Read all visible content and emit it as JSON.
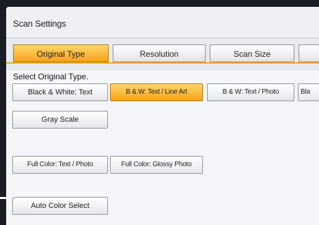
{
  "title": "Scan Settings",
  "tabs": [
    {
      "label": "Original Type"
    },
    {
      "label": "Resolution"
    },
    {
      "label": "Scan Size"
    }
  ],
  "prompt": "Select Original Type.",
  "options": {
    "bw_text": "Black & White: Text",
    "bw_text_line_art": "B & W: Text / Line Art",
    "bw_text_photo": "B & W: Text / Photo",
    "partial": "Bla",
    "gray_scale": "Gray Scale",
    "fc_text_photo": "Full Color: Text / Photo",
    "fc_glossy_photo": "Full Color: Glossy Photo",
    "auto_color_select": "Auto Color Select"
  },
  "selected_option": "B & W: Text / Line Art",
  "colors": {
    "accent": "#f5a31a",
    "panel": "#f3f5f8",
    "frame": "#1b1d24"
  }
}
